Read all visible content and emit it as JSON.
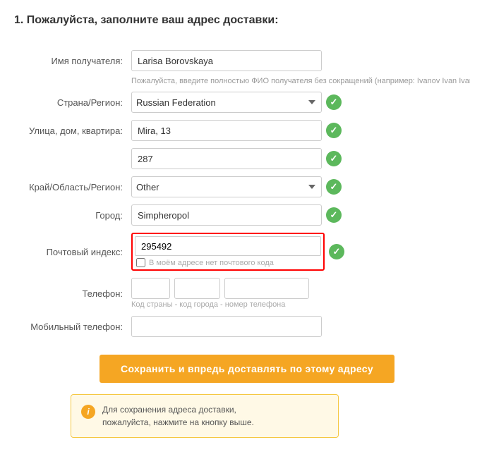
{
  "page": {
    "title": "1. Пожалуйста, заполните ваш адрес доставки:"
  },
  "form": {
    "recipient_label": "Имя получателя:",
    "recipient_value": "Larisa Borovskaya",
    "recipient_hint": "Пожалуйста, введите полностью ФИО получателя без сокращений (например: Ivanov Ivan Ivano",
    "country_label": "Страна/Регион:",
    "country_value": "Russian Federation",
    "country_options": [
      "Russian Federation"
    ],
    "street_label": "Улица, дом, квартира:",
    "street_value": "Mira, 13",
    "street2_value": "287",
    "region_label": "Край/Область/Регион:",
    "region_value": "Other",
    "region_options": [
      "Other"
    ],
    "city_label": "Город:",
    "city_value": "Simpheropol",
    "zip_label": "Почтовый индекс:",
    "zip_value": "295492",
    "no_zip_label": "В моём адресе нет почтового кода",
    "phone_label": "Телефон:",
    "phone_hint": "Код страны - код города - номер телефона",
    "mobile_label": "Мобильный телефон:",
    "save_button": "Сохранить и впредь доставлять по этому адресу",
    "info_text": "Для сохранения адреса доставки,\nпожалуйста, нажмите на кнопку выше."
  }
}
